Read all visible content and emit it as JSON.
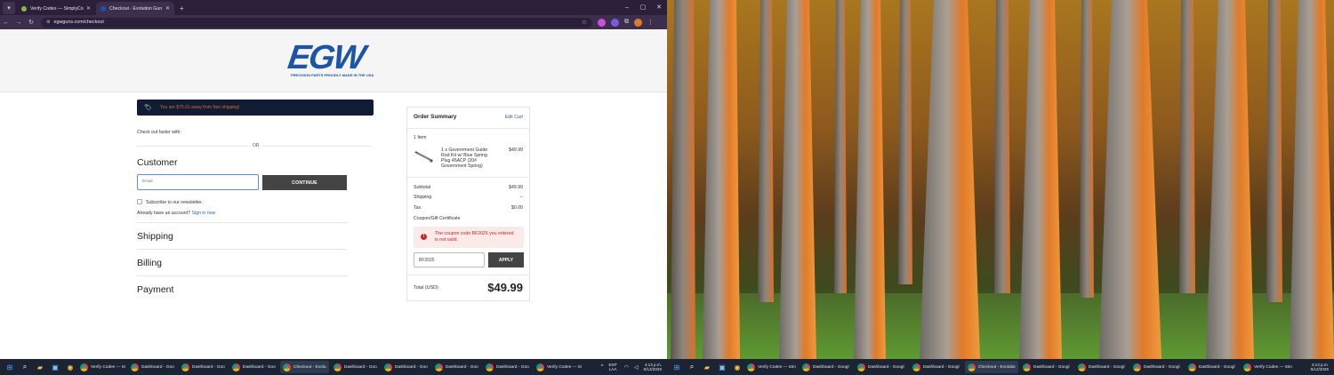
{
  "browser": {
    "tabs": [
      {
        "title": "Verify Codes — SimplyCodes",
        "favicon_color": "#7bc043",
        "active": false
      },
      {
        "title": "Checkout - Evolution Gun Works",
        "favicon_color": "#1c55a8",
        "active": true
      }
    ],
    "new_tab": "+",
    "url": "egwguns.com/checkout"
  },
  "site": {
    "logo_text": "EGW",
    "logo_tagline": "PRECISION PARTS PROUDLY MADE IN THE USA"
  },
  "checkout": {
    "shipping_banner": "You are $75.01 away from free shipping!",
    "checkout_faster": "Check out faster with:",
    "or": "OR",
    "customer_title": "Customer",
    "email_placeholder": "Email",
    "continue_label": "CONTINUE",
    "newsletter_label": "Subscribe to our newsletter.",
    "account_prompt": "Already have an account?",
    "sign_in": "Sign in now",
    "shipping_title": "Shipping",
    "billing_title": "Billing",
    "payment_title": "Payment"
  },
  "summary": {
    "title": "Order Summary",
    "edit_cart": "Edit Cart",
    "item_count": "1 Item",
    "product_name": "1 x Government Guide Rod Kit w/ Blue Spring Plug 45ACP (20# Government Spring)",
    "product_price": "$49.99",
    "subtotal_label": "Subtotal",
    "subtotal_value": "$49.99",
    "shipping_label": "Shipping",
    "shipping_value": "--",
    "tax_label": "Tax",
    "tax_value": "$0.00",
    "coupon_label": "Coupon/Gift Certificate",
    "error_message": "The coupon code BF2025 you entered is not valid.",
    "coupon_value": "BF2025",
    "apply_label": "APPLY",
    "total_label": "Total (USD)",
    "total_value": "$49.99"
  },
  "taskbar_left": {
    "items": [
      {
        "label": "Verify Codes — Si",
        "active": false
      },
      {
        "label": "Dashboard - Goo",
        "active": false
      },
      {
        "label": "Dashboard - Goo",
        "active": false
      },
      {
        "label": "Dashboard - Goo",
        "active": false
      },
      {
        "label": "Checkout - Evolu",
        "active": true
      },
      {
        "label": "Dashboard - Goo",
        "active": false
      },
      {
        "label": "Dashboard - Goo",
        "active": false
      },
      {
        "label": "Dashboard - Goo",
        "active": false
      },
      {
        "label": "Dashboard - Goo",
        "active": false
      },
      {
        "label": "Verify Codes — Si",
        "active": false
      }
    ],
    "lang_top": "ESP",
    "lang_bottom": "LAA",
    "time": "4:13 p.m.",
    "date": "5/12/2025"
  },
  "taskbar_right": {
    "items": [
      {
        "label": "Verify Codes — Sim",
        "active": false
      },
      {
        "label": "Dashboard - Googl",
        "active": false
      },
      {
        "label": "Dashboard - Googl",
        "active": false
      },
      {
        "label": "Dashboard - Googl",
        "active": false
      },
      {
        "label": "Checkout - Evolutio",
        "active": true
      },
      {
        "label": "Dashboard - Googl",
        "active": false
      },
      {
        "label": "Dashboard - Googl",
        "active": false
      },
      {
        "label": "Dashboard - Googl",
        "active": false
      },
      {
        "label": "Dashboard - Googl",
        "active": false
      },
      {
        "label": "Verify Codes — Sim",
        "active": false
      }
    ],
    "time": "4:13 p.m.",
    "date": "5/12/2025"
  },
  "colors": {
    "accent_blue": "#1c55a8",
    "banner_bg": "#0f1c33",
    "banner_text": "#e6632c",
    "error": "#c62828"
  }
}
